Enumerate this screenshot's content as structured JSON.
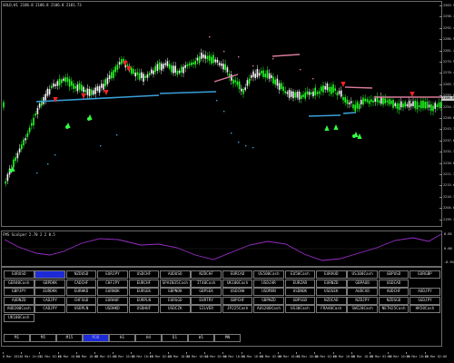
{
  "chart_header": "GOLD,H1  2106.8  2106.8  2106.8  2101.73",
  "indicator_header": "FMS Scalper 2.70 2 2 0.5",
  "colors": {
    "bull": "#22ff22",
    "bear": "#f4f4f4",
    "signal_up": "#33ff44",
    "signal_down": "#ff2222",
    "line_blue": "#3aa0d8",
    "line_pink": "#d87a9a",
    "oscillator": "#9a2ec8",
    "button_active": "#1d2ad6"
  },
  "price_axis": {
    "labels": [
      "2303.90",
      "2298.70",
      "2292.45",
      "2286.95",
      "2281.45",
      "2275.95",
      "2270.45",
      "2265.15",
      "2259.65",
      "2254.15",
      "2248.65",
      "2243.15",
      "2237.65",
      "2232.15",
      "2226.65",
      "2221.15",
      "2215.65",
      "2210.15",
      "2204.65",
      "2199.15"
    ],
    "current_price": "2106.8"
  },
  "indicator_axis": {
    "labels": [
      "8.85",
      "0.00",
      "-8.94"
    ]
  },
  "time_axis": {
    "labels": [
      "8 Mar 2024",
      "8 Mar 14:00",
      "11 Mar 02:00",
      "11 Mar 10:00",
      "11 Mar 18:00",
      "12 Mar 02:00",
      "12 Mar 10:00",
      "12 Mar 18:00",
      "13 Mar 02:00",
      "13 Mar 10:00",
      "13 Mar 18:00",
      "14 Mar 02:00",
      "14 Mar 10:00",
      "14 Mar 18:00",
      "15 Mar 02:00",
      "15 Mar 10:00",
      "15 Mar 18:00",
      "18 Mar 02:00",
      "18 Mar 10:00",
      "18 Mar 18:00",
      "19 Mar 02:00",
      "19 Mar 10:00",
      "19 Mar 18:00",
      "20 Mar 02:00"
    ]
  },
  "pair_buttons": [
    [
      "EURUSD",
      "GBPUSD",
      "NZDUSD",
      "EURJPY",
      "USDCHF",
      "AUDUSD",
      "NZDCHF",
      "EURCAD",
      "US500Cash",
      "EU50Cash",
      "EURAUD",
      "US100Cash",
      "GBPUSD",
      "EURGBP"
    ],
    [
      "GER40Cash",
      "GBPDKK",
      "CADCHF",
      "CHFJPY",
      "EURCHF",
      "SPAIN35Cash",
      "IT40Cash",
      "UK100Cash",
      "USDJAR",
      "EURZAR",
      "EURNZD",
      "GBPAUD",
      "USDCAD"
    ],
    [
      "GBPJPY",
      "EURDKK",
      "EURHKD",
      "EURNOK",
      "EURSEK",
      "GBPNOK",
      "GBPSEK",
      "USDCNH",
      "USDMXN",
      "USDNOK",
      "USDSEK",
      "AUDCAD",
      "AUDCHF",
      "AUDJPY"
    ],
    [
      "AUDNZD",
      "CADJPY",
      "CHFSGD",
      "EURHUF",
      "EURPLN",
      "EURSGD",
      "EURTRY",
      "GBPCHF",
      "GBPNZD",
      "GBPSGD",
      "NZDCAD",
      "NZDJPY",
      "NZDSGD",
      "SGDJPY"
    ],
    [
      "AUD200Cash",
      "CADJPY",
      "USDPLN",
      "USDHKD",
      "USDHUF",
      "USDCZK",
      "SILVER",
      "JP225Cash",
      "AUS200Cash",
      "US30Cash",
      "FRA40Cash",
      "SWI20Cash",
      "NETH25Cash",
      "HK50Cash"
    ],
    [
      "UK100Cash"
    ]
  ],
  "active_pair": "GBPUSD",
  "timeframes": [
    "M1",
    "M5",
    "M15",
    "M30",
    "H1",
    "H4",
    "D1",
    "W1",
    "MN"
  ],
  "active_timeframe": "M30"
}
